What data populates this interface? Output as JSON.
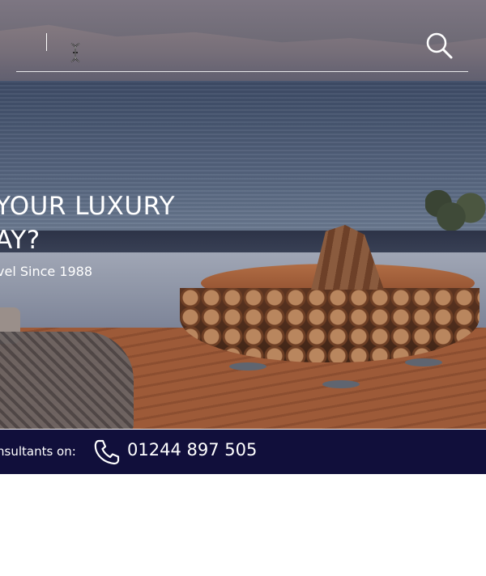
{
  "search": {
    "placeholder": "",
    "value": ""
  },
  "hero": {
    "headline_line1": "YOUR LUXURY",
    "headline_line2": "AY?",
    "subheadline": "vel Since 1988"
  },
  "contact": {
    "label": "nsultants on:",
    "phone": "01244 897 505",
    "bar_color": "#110f3b"
  },
  "icons": {
    "search": "search-icon",
    "phone": "phone-icon",
    "text_cursor": "text-cursor-icon"
  }
}
